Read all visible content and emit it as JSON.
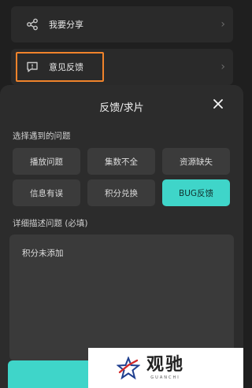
{
  "menu": {
    "share": {
      "label": "我要分享",
      "icon": "share-icon"
    },
    "feedback": {
      "label": "意见反馈",
      "icon": "feedback-icon"
    }
  },
  "sheet": {
    "title": "反馈/求片",
    "choose_label": "选择遇到的问题",
    "options": [
      {
        "label": "播放问题",
        "selected": false
      },
      {
        "label": "集数不全",
        "selected": false
      },
      {
        "label": "资源缺失",
        "selected": false
      },
      {
        "label": "信息有误",
        "selected": false
      },
      {
        "label": "积分兑换",
        "selected": false
      },
      {
        "label": "BUG反馈",
        "selected": true
      }
    ],
    "detail_label": "详细描述问题 (必填)",
    "detail_value": "积分未添加"
  },
  "watermark": {
    "cn": "观驰",
    "en": "GUANCHI"
  },
  "colors": {
    "accent": "#3fd5c9",
    "highlight": "#f0832b",
    "background": "#1f1f1f"
  }
}
